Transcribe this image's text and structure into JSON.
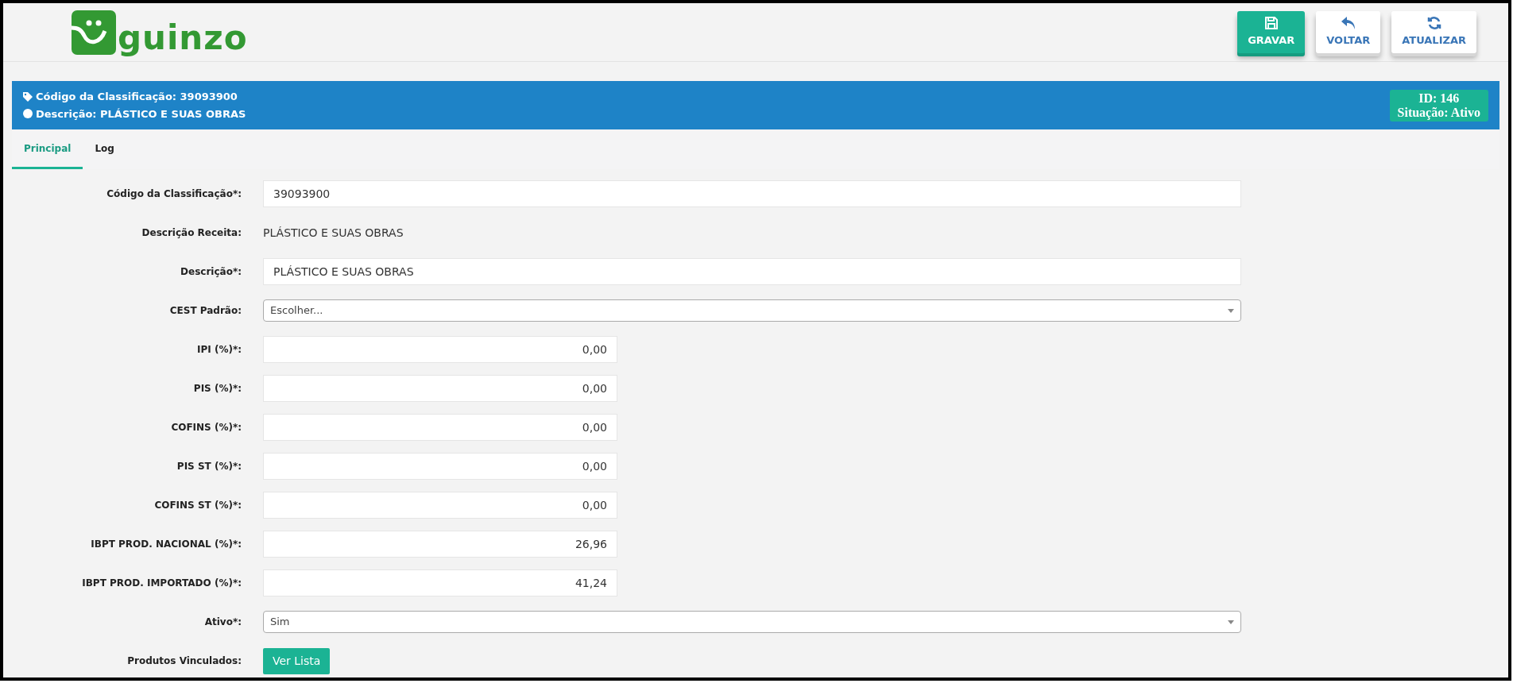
{
  "logo": {
    "text": "guinzo"
  },
  "toolbar": [
    {
      "label": "GRAVAR",
      "kind": "save",
      "primary": true
    },
    {
      "label": "VOLTAR",
      "kind": "back",
      "primary": false
    },
    {
      "label": "ATUALIZAR",
      "kind": "refresh",
      "primary": false
    }
  ],
  "banner": {
    "code": "Código da Classificação: 39093900",
    "description": "Descrição: PLÁSTICO E SUAS OBRAS",
    "id": "ID: 146",
    "status": "Situação: Ativo"
  },
  "tabs": [
    {
      "label": "Principal",
      "selected": true
    },
    {
      "label": "Log",
      "selected": false
    }
  ],
  "form": [
    {
      "kind": "input",
      "label": "Código da Classificação*:",
      "value": "39093900"
    },
    {
      "kind": "text",
      "label": "Descrição Receita:",
      "value": "PLÁSTICO E SUAS OBRAS"
    },
    {
      "kind": "input",
      "label": "Descrição*:",
      "value": "PLÁSTICO E SUAS OBRAS"
    },
    {
      "kind": "select",
      "label": "CEST Padrão:",
      "value": "Escolher..."
    },
    {
      "kind": "number",
      "label": "IPI (%)*:",
      "value": "0,00"
    },
    {
      "kind": "number",
      "label": "PIS (%)*:",
      "value": "0,00"
    },
    {
      "kind": "number",
      "label": "COFINS (%)*:",
      "value": "0,00"
    },
    {
      "kind": "number",
      "label": "PIS ST (%)*:",
      "value": "0,00"
    },
    {
      "kind": "number",
      "label": "COFINS ST (%)*:",
      "value": "0,00"
    },
    {
      "kind": "number",
      "label": "IBPT PROD. NACIONAL (%)*:",
      "value": "26,96"
    },
    {
      "kind": "number",
      "label": "IBPT PROD. IMPORTADO (%)*:",
      "value": "41,24"
    },
    {
      "kind": "select",
      "label": "Ativo*:",
      "value": "Sim"
    },
    {
      "kind": "button",
      "label": "Produtos Vinculados:",
      "value": "Ver Lista"
    }
  ]
}
